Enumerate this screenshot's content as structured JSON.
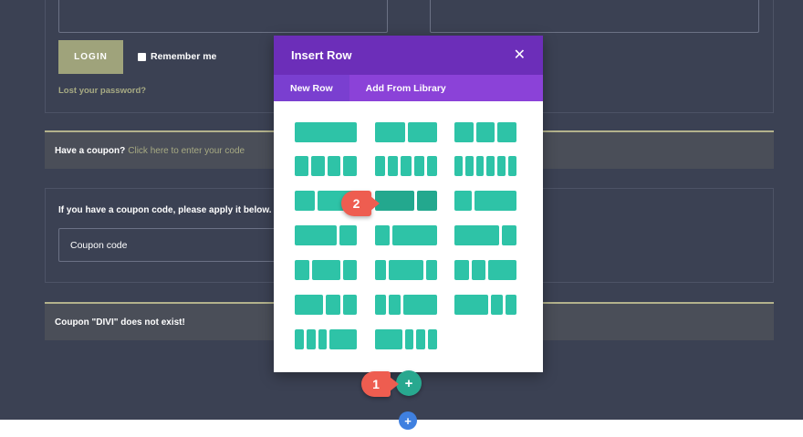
{
  "login": {
    "button_label": "LOGIN",
    "remember_label": "Remember me",
    "lost_password": "Lost your password?"
  },
  "coupon_notice": {
    "prefix": "Have a coupon?",
    "link": "Click here to enter your code"
  },
  "coupon_form": {
    "instruction": "If you have a coupon code, please apply it below.",
    "input_placeholder": "Coupon code"
  },
  "error_notice": "Coupon \"DIVI\" does not exist!",
  "modal": {
    "title": "Insert Row",
    "close_icon": "close-icon",
    "tabs": [
      {
        "label": "New Row",
        "active": true
      },
      {
        "label": "Add From Library",
        "active": false
      }
    ],
    "layouts": [
      {
        "name": "1",
        "cols": [
          4
        ]
      },
      {
        "name": "1/2+1/2",
        "cols": [
          2,
          2
        ]
      },
      {
        "name": "1/3x3",
        "cols": [
          1,
          1,
          1
        ]
      },
      {
        "name": "1/4x4",
        "cols": [
          1,
          1,
          1,
          1
        ]
      },
      {
        "name": "1/5x5",
        "cols": [
          1,
          1,
          1,
          1,
          1
        ]
      },
      {
        "name": "1/6x6",
        "cols": [
          1,
          1,
          1,
          1,
          1,
          1
        ]
      },
      {
        "name": "1/3+2/3",
        "cols": [
          1,
          2
        ]
      },
      {
        "name": "2/3+1/3",
        "cols": [
          2,
          1
        ],
        "highlighted": true
      },
      {
        "name": "1/4+3/4",
        "cols": [
          1,
          2.4
        ]
      },
      {
        "name": "3/4+1/4",
        "cols": [
          2.4,
          1
        ]
      },
      {
        "name": "1/5+4/5",
        "cols": [
          1,
          3
        ]
      },
      {
        "name": "4/5+1/5",
        "cols": [
          3,
          1
        ]
      },
      {
        "name": "1/4+1/2+1/4",
        "cols": [
          1,
          2,
          1
        ]
      },
      {
        "name": "1/5+3/5+1/5",
        "cols": [
          1,
          3,
          1
        ]
      },
      {
        "name": "1/4+1/4+1/2",
        "cols": [
          1,
          1,
          2
        ]
      },
      {
        "name": "1/2+1/4+1/4",
        "cols": [
          2,
          1,
          1
        ]
      },
      {
        "name": "1/5+1/5+3/5",
        "cols": [
          1,
          1,
          3
        ]
      },
      {
        "name": "3/5+1/5+1/5",
        "cols": [
          3,
          1,
          1
        ]
      },
      {
        "name": "1/6+1/6+1/6+1/2",
        "cols": [
          1,
          1,
          1,
          3
        ]
      },
      {
        "name": "1/2+1/6+1/6+1/6",
        "cols": [
          3,
          1,
          1,
          1
        ]
      }
    ]
  },
  "plus_teal": "+",
  "plus_blue": "+",
  "steps": [
    "1",
    "2"
  ],
  "colors": {
    "header_purple": "#6c2eb9",
    "tab_purple": "#8b42d8",
    "layout_teal": "#2ec3a7",
    "layout_teal_hover": "#23a88e",
    "page_dark": "#3b4153",
    "step_red": "#ee5d50",
    "plus_blue": "#3f80e0"
  }
}
